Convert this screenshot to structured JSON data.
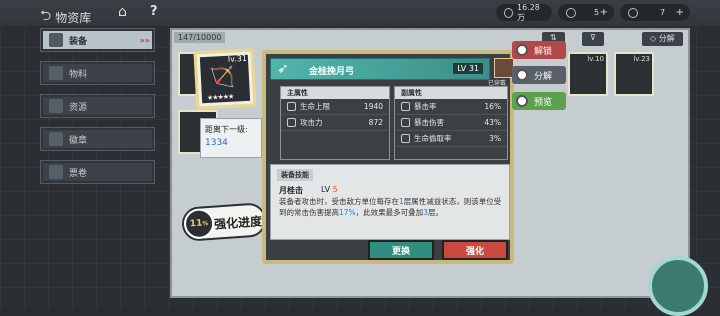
{
  "topbar": {
    "back_label": "物资库",
    "resources": [
      {
        "value": "16.28万"
      },
      {
        "value": "5"
      },
      {
        "value": "7"
      }
    ]
  },
  "sidebar": {
    "items": [
      {
        "label": "装备",
        "active": true,
        "tag": "»»"
      },
      {
        "label": "物料",
        "active": false
      },
      {
        "label": "资源",
        "active": false
      },
      {
        "label": "徽章",
        "active": false
      },
      {
        "label": "票卷",
        "active": false
      }
    ]
  },
  "inventory": {
    "count": "147/10000",
    "decompose_label": "分解",
    "slots": [
      {
        "lv": "lv.10"
      },
      {
        "lv": "lv.23"
      }
    ]
  },
  "selected": {
    "level": "lv.31",
    "next_level_label": "距离下一级:",
    "next_level_value": "1334",
    "progress_percent": "11",
    "progress_unit": "%",
    "progress_label": "强化进度"
  },
  "detail": {
    "name": "金桂挽月弓",
    "level": "LV 31",
    "owner_label": "已穿戴",
    "main_stats_title": "主属性",
    "main_stats": [
      {
        "label": "生命上限",
        "value": "1940"
      },
      {
        "label": "攻击力",
        "value": "872"
      }
    ],
    "sub_stats_title": "副属性",
    "sub_stats": [
      {
        "label": "暴击率",
        "value": "16%"
      },
      {
        "label": "暴击伤害",
        "value": "43%"
      },
      {
        "label": "生命偷取率",
        "value": "3%"
      }
    ],
    "skill_title": "装备技能",
    "skill_name": "月桂击",
    "skill_lv_prefix": "LV",
    "skill_lv": "5",
    "skill_desc_1": "装备者攻击时，受击敌方单位每存在",
    "skill_desc_hl1": "1",
    "skill_desc_2": "层属性减益状态，则该单位受到的常击伤害提高",
    "skill_desc_hl2": "17%",
    "skill_desc_3": "，此效果最多可叠加",
    "skill_desc_hl3": "3",
    "skill_desc_4": "层。",
    "swap_label": "更换",
    "upgrade_label": "强化"
  },
  "actions": {
    "unlock_label": "解锁",
    "decompose_label": "分解",
    "preview_label": "预览"
  },
  "colors": {
    "accent_teal": "#4fb6ac",
    "upgrade_red": "#c94a3e",
    "highlight_blue": "#1f7bd6",
    "gold_border": "#c9b97f"
  }
}
